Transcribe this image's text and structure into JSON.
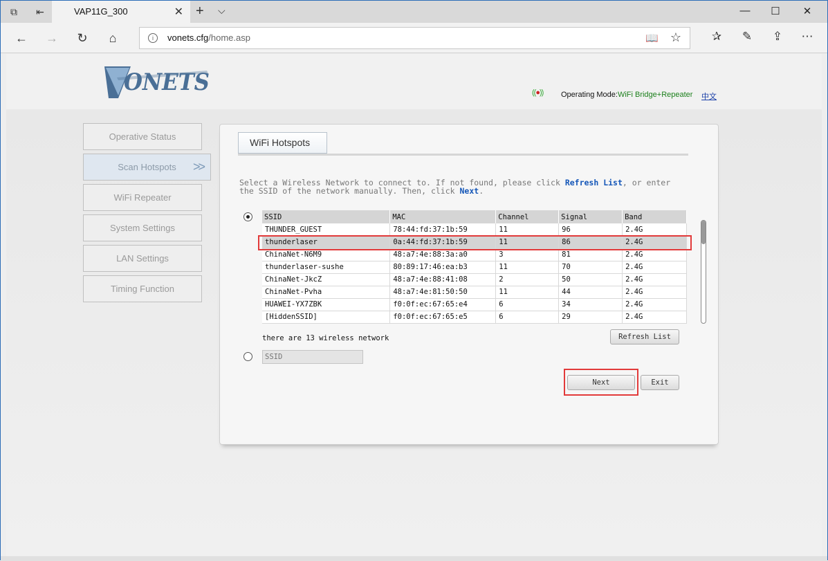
{
  "browser": {
    "tab_title": "VAP11G_300",
    "url_host": "vonets.cfg",
    "url_path": "/home.asp"
  },
  "header": {
    "logo_text": "VONETS",
    "op_mode_label": "Operating Mode:",
    "op_mode_value": "WiFi Bridge+Repeater",
    "lang_link": "中文"
  },
  "sidebar": {
    "items": [
      {
        "label": "Operative Status"
      },
      {
        "label": "Scan Hotspots"
      },
      {
        "label": "WiFi Repeater"
      },
      {
        "label": "System Settings"
      },
      {
        "label": "LAN Settings"
      },
      {
        "label": "Timing Function"
      }
    ]
  },
  "panel": {
    "title": "WiFi Hotspots",
    "instr_1": "Select a Wireless Network to connect to. If not found, please click ",
    "instr_refresh": "Refresh List",
    "instr_2": ", or enter the SSID of the network manually. Then, click ",
    "instr_next": "Next",
    "instr_3": "."
  },
  "table": {
    "columns": [
      "SSID",
      "MAC",
      "Channel",
      "Signal",
      "Band"
    ],
    "rows": [
      [
        "THUNDER_GUEST",
        "78:44:fd:37:1b:59",
        "11",
        "96",
        "2.4G"
      ],
      [
        "thunderlaser",
        "0a:44:fd:37:1b:59",
        "11",
        "86",
        "2.4G"
      ],
      [
        "ChinaNet-N6M9",
        "48:a7:4e:88:3a:a0",
        "3",
        "81",
        "2.4G"
      ],
      [
        "thunderlaser-sushe",
        "80:89:17:46:ea:b3",
        "11",
        "70",
        "2.4G"
      ],
      [
        "ChinaNet-JkcZ",
        "48:a7:4e:88:41:08",
        "2",
        "50",
        "2.4G"
      ],
      [
        "ChinaNet-Pvha",
        "48:a7:4e:81:50:50",
        "11",
        "44",
        "2.4G"
      ],
      [
        "HUAWEI-YX7ZBK",
        "f0:0f:ec:67:65:e4",
        "6",
        "34",
        "2.4G"
      ],
      [
        "[HiddenSSID]",
        "f0:0f:ec:67:65:e5",
        "6",
        "29",
        "2.4G"
      ]
    ]
  },
  "count_text": "there are 13 wireless network",
  "buttons": {
    "refresh": "Refresh List",
    "next": "Next",
    "exit": "Exit"
  },
  "ssid_input": {
    "placeholder": "SSID"
  }
}
